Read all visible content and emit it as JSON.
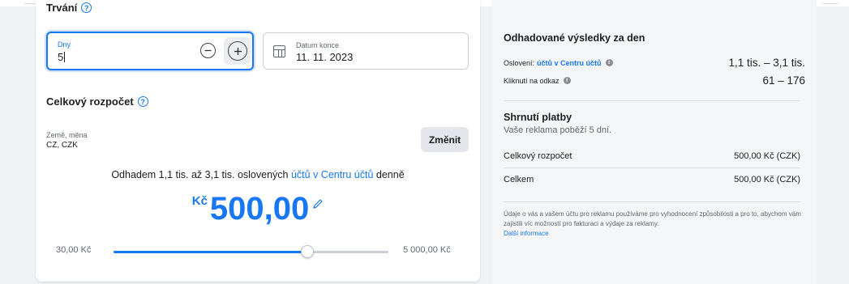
{
  "duration": {
    "title": "Trvání",
    "days_label": "Dny",
    "days_value": "5",
    "end_date_label": "Datum konce",
    "end_date_value": "11. 11. 2023"
  },
  "budget": {
    "title": "Celkový rozpočet",
    "country_label": "Země, měna",
    "country_value": "CZ, CZK",
    "change_button": "Změnit",
    "estimate_prefix": "Odhadem 1,1 tis. až 3,1 tis. oslovených",
    "estimate_link": "účtů v Centru účtů",
    "estimate_suffix": "denně",
    "currency_symbol": "Kč",
    "amount": "500,00",
    "slider_min": "30,00 Kč",
    "slider_max": "5 000,00 Kč",
    "slider_position": 0.706
  },
  "results": {
    "title": "Odhadované výsledky za den",
    "reach_label": "Oslovení:",
    "reach_link": "účtů v Centru účtů",
    "reach_value": "1,1 tis. – 3,1 tis.",
    "clicks_label": "Kliknutí na odkaz",
    "clicks_value": "61 – 176"
  },
  "payment": {
    "title": "Shrnutí platby",
    "subtitle": "Vaše reklama poběží 5 dní.",
    "total_budget_label": "Celkový rozpočet",
    "total_budget_value": "500,00 Kč (CZK)",
    "total_label": "Celkem",
    "total_value": "500,00 Kč (CZK)"
  },
  "disclaimer": {
    "text": "Údaje o vás a vašem účtu pro reklamu používáme pro vyhodnocení způsobilosti a pro to, abychom vám zajistili víc možností pro fakturaci a výdaje za reklamy.",
    "link": "Další informace"
  },
  "colors": {
    "accent": "#1877f2",
    "text": "#1c1e21",
    "secondary_text": "#606770",
    "background": "#f0f2f5"
  }
}
